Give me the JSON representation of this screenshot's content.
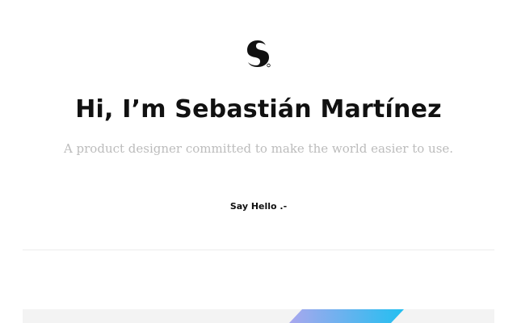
{
  "header": {
    "logo_icon": "s-monogram-logo-icon"
  },
  "hero": {
    "title": "Hi, I’m Sebastián Martínez",
    "subtitle": "A product designer committed to make the world easier to use.",
    "cta_label": "Say Hello .-"
  },
  "colors": {
    "title": "#111111",
    "subtitle": "#bcbcbc",
    "divider": "#ececec",
    "strip_bg": "#f3f3f3",
    "gradient_start": "#a9a7ee",
    "gradient_end": "#22bff0"
  }
}
